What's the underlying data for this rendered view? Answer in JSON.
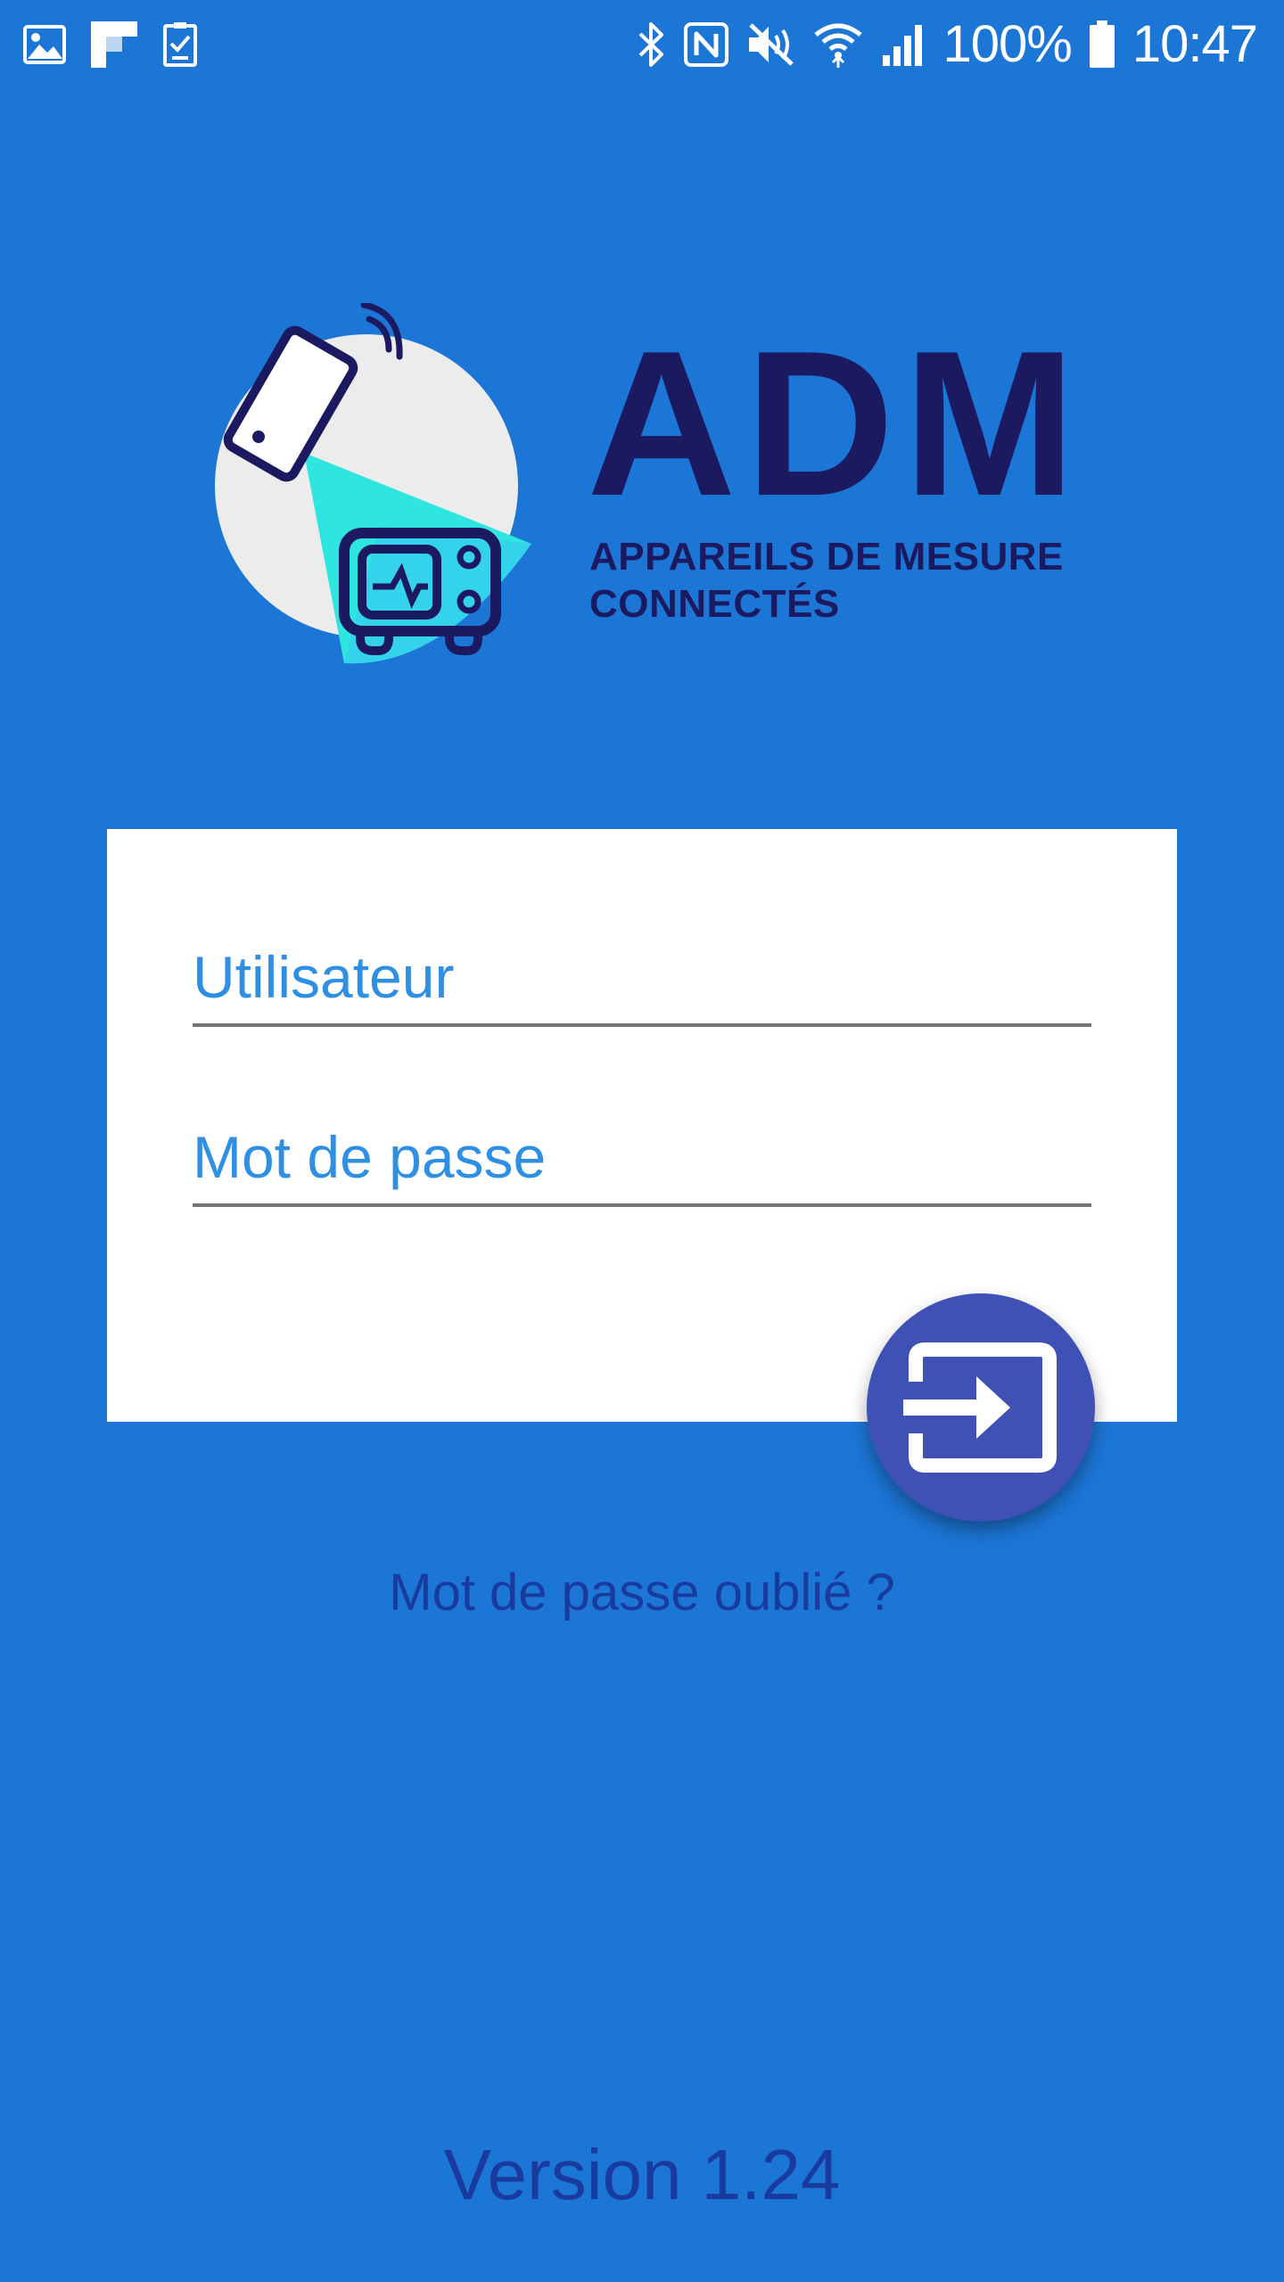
{
  "status_bar": {
    "left_icons": [
      "gallery-icon",
      "flipboard-icon",
      "clipboard-check-icon"
    ],
    "right_icons": [
      "bluetooth-icon",
      "nfc-icon",
      "mute-icon",
      "wifi-icon",
      "signal-icon"
    ],
    "battery": "100%",
    "time": "10:47"
  },
  "logo": {
    "name": "ADM",
    "tagline_line1": "APPAREILS DE MESURE",
    "tagline_line2": "CONNECTÉS"
  },
  "login": {
    "username_placeholder": "Utilisateur",
    "password_placeholder": "Mot de passe",
    "submit_icon": "login-icon"
  },
  "forgot_password": "Mot de passe oublié ?",
  "version": "Version 1.24",
  "colors": {
    "background": "#1c76d6",
    "card": "#ffffff",
    "fab": "#3f51b5",
    "brand": "#1b1960",
    "accent": "#2f8fe2",
    "link": "#1a3b9e"
  }
}
